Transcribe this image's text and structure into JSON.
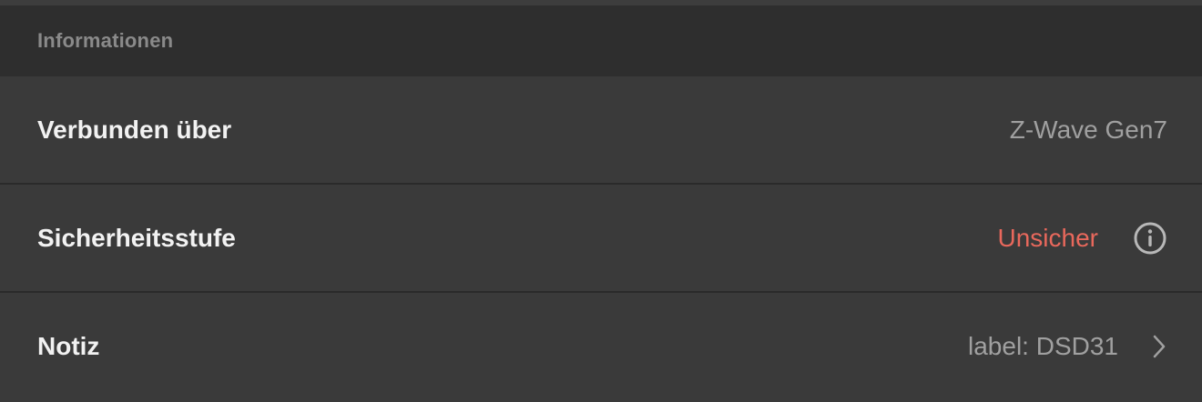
{
  "section": {
    "title": "Informationen"
  },
  "rows": [
    {
      "label": "Verbunden über",
      "value": "Z-Wave Gen7"
    },
    {
      "label": "Sicherheitsstufe",
      "value": "Unsicher",
      "value_color": "#e8685c",
      "icon": "info-icon"
    },
    {
      "label": "Notiz",
      "value": "label: DSD31",
      "icon": "chevron-right-icon"
    }
  ]
}
